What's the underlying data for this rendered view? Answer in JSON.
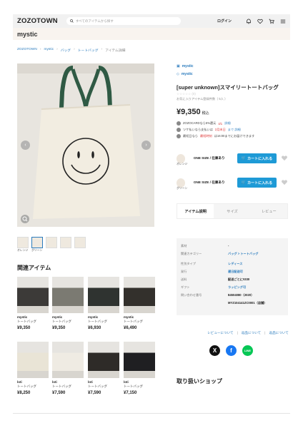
{
  "header": {
    "logo": "ZOZOTOWN",
    "search_placeholder": "すべてのアイテムから探す",
    "login": "ログイン",
    "shop_name": "mystic"
  },
  "breadcrumb": [
    "ZOZOTOWN",
    "mystic",
    "バッグ",
    "トートバッグ",
    "アイテム詳細"
  ],
  "thumbnails": [
    {
      "caption": "オレンジ"
    },
    {
      "caption": "グリーン"
    },
    {
      "caption": ""
    },
    {
      "caption": ""
    },
    {
      "caption": ""
    }
  ],
  "product": {
    "brand1": "mystic",
    "brand2": "mystic",
    "title": "[super unknown]スマイリートートバッグ",
    "stars": "☆☆☆☆☆ (0)",
    "favorites": "お気に入りアイテム登録件数（ 5人 ）",
    "price": "¥9,350",
    "tax": "税込",
    "info": [
      {
        "pre": "ZOZOCARDなら5%還元",
        "hl": "4/1",
        "post": "詳細"
      },
      {
        "pre": "ツケ払いなら支払いは",
        "hl": "2月末日",
        "post": "まで 詳細"
      },
      {
        "pre": "最短日なら",
        "hl": "最短時刻",
        "post": "は16:00までにお届けできます"
      }
    ]
  },
  "skus": [
    {
      "caption": "オレンジ",
      "text": "ONE SIZE / 在庫あり",
      "button": "カートに入れる"
    },
    {
      "caption": "グリーン",
      "text": "ONE SIZE / 在庫あり",
      "button": "カートに入れる"
    }
  ],
  "tabs": [
    "アイテム説明",
    "サイズ",
    "レビュー"
  ],
  "spec": [
    {
      "k": "素材",
      "v": "-"
    },
    {
      "k": "関連カテゴリー",
      "v": "バッグ > トートバッグ"
    },
    {
      "k": "性別タイプ",
      "v": "レディース"
    },
    {
      "k": "発行",
      "v": "遅日配送可"
    },
    {
      "k": "送料",
      "v": "配送ごとに¥330"
    },
    {
      "k": "ギフト",
      "v": "ラッピング可"
    },
    {
      "k": "問い合わせ番号",
      "v": "84504080（2020）"
    },
    {
      "k": "",
      "v": "MYZ104141ZC0001（店舗）"
    }
  ],
  "footer_links": [
    "レビューについて",
    "返品について",
    "返品について"
  ],
  "shop_title": "取り扱いショップ",
  "related": {
    "heading": "関連アイテム",
    "items": [
      {
        "brand": "mystic",
        "cat": "トートバッグ",
        "price": "¥9,350",
        "color": "#3c3a38"
      },
      {
        "brand": "mystic",
        "cat": "トートバッグ",
        "price": "¥9,350",
        "color": "#7b7a72"
      },
      {
        "brand": "mystic",
        "cat": "トートバッグ",
        "price": "¥6,930",
        "color": "#2f3330"
      },
      {
        "brand": "mystic",
        "cat": "トートバッグ",
        "price": "¥6,490",
        "color": "#33302c"
      },
      {
        "brand": "loti",
        "cat": "トートバッグ",
        "price": "¥8,250",
        "color": "#e9e4d6"
      },
      {
        "brand": "loti",
        "cat": "トートバッグ",
        "price": "¥7,590",
        "color": "#efebe3"
      },
      {
        "brand": "loti",
        "cat": "トートバッグ",
        "price": "¥7,590",
        "color": "#2e2b28"
      },
      {
        "brand": "loti",
        "cat": "トートバッグ",
        "price": "¥7,150",
        "color": "#1f1f22"
      }
    ]
  },
  "colors": {
    "accent": "#2a7bbd",
    "cart": "#1e9ad6",
    "strap_green": "#2f5a44",
    "x_black": "#111111",
    "fb_blue": "#1877f2",
    "line_green": "#06c755"
  }
}
